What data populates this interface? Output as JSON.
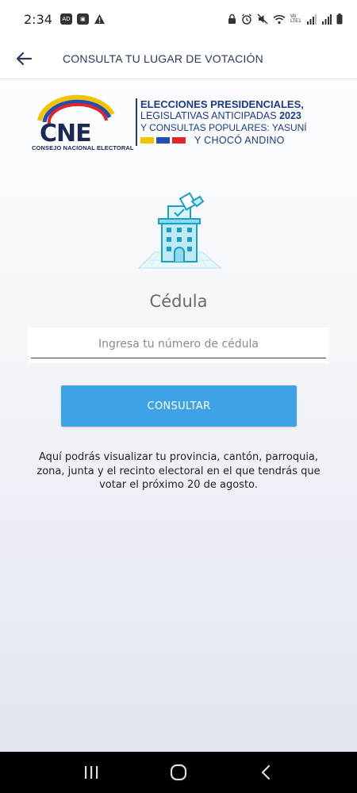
{
  "status_bar": {
    "time": "2:34",
    "left_icons": [
      "ad-icon",
      "app-icon",
      "warning-icon"
    ],
    "right_icons": [
      "lock-icon",
      "alarm-icon",
      "mute-icon",
      "wifi-icon",
      "volte-icon",
      "signal-icon",
      "signal-icon",
      "battery-icon"
    ],
    "volte_label": "Vo LTE1"
  },
  "header": {
    "title": "CONSULTA TU LUGAR DE VOTACIÓN",
    "back_icon": "arrow-left-icon"
  },
  "logo": {
    "brand": "CNE",
    "brand_subtitle": "CONSEJO NACIONAL ELECTORAL",
    "line1": "ELECCIONES PRESIDENCIALES,",
    "line2_prefix": "LEGISLATIVAS ANTICIPADAS",
    "line2_year": "2023",
    "line3": "Y CONSULTAS POPULARES: YASUNÍ",
    "line4": "Y CHOCÓ ANDINO",
    "colors": {
      "navy": "#1b3a8a",
      "yellow": "#f2c400",
      "blue": "#1f4fb4",
      "red": "#e0252b"
    }
  },
  "illustration": {
    "icon": "ballot-building-icon"
  },
  "form": {
    "label": "Cédula",
    "input_placeholder": "Ingresa tu número de cédula",
    "input_value": "",
    "button_label": "CONSULTAR"
  },
  "info": {
    "text": "Aquí podrás visualizar tu provincia, cantón, parroquia, zona, junta y el recinto electoral en el que tendrás que votar el próximo 20 de agosto."
  },
  "nav_bar": {
    "icons": [
      "recent-apps-icon",
      "home-icon",
      "back-icon"
    ]
  },
  "colors": {
    "accent": "#3ea3e6",
    "header_text": "#2a3a5a"
  }
}
